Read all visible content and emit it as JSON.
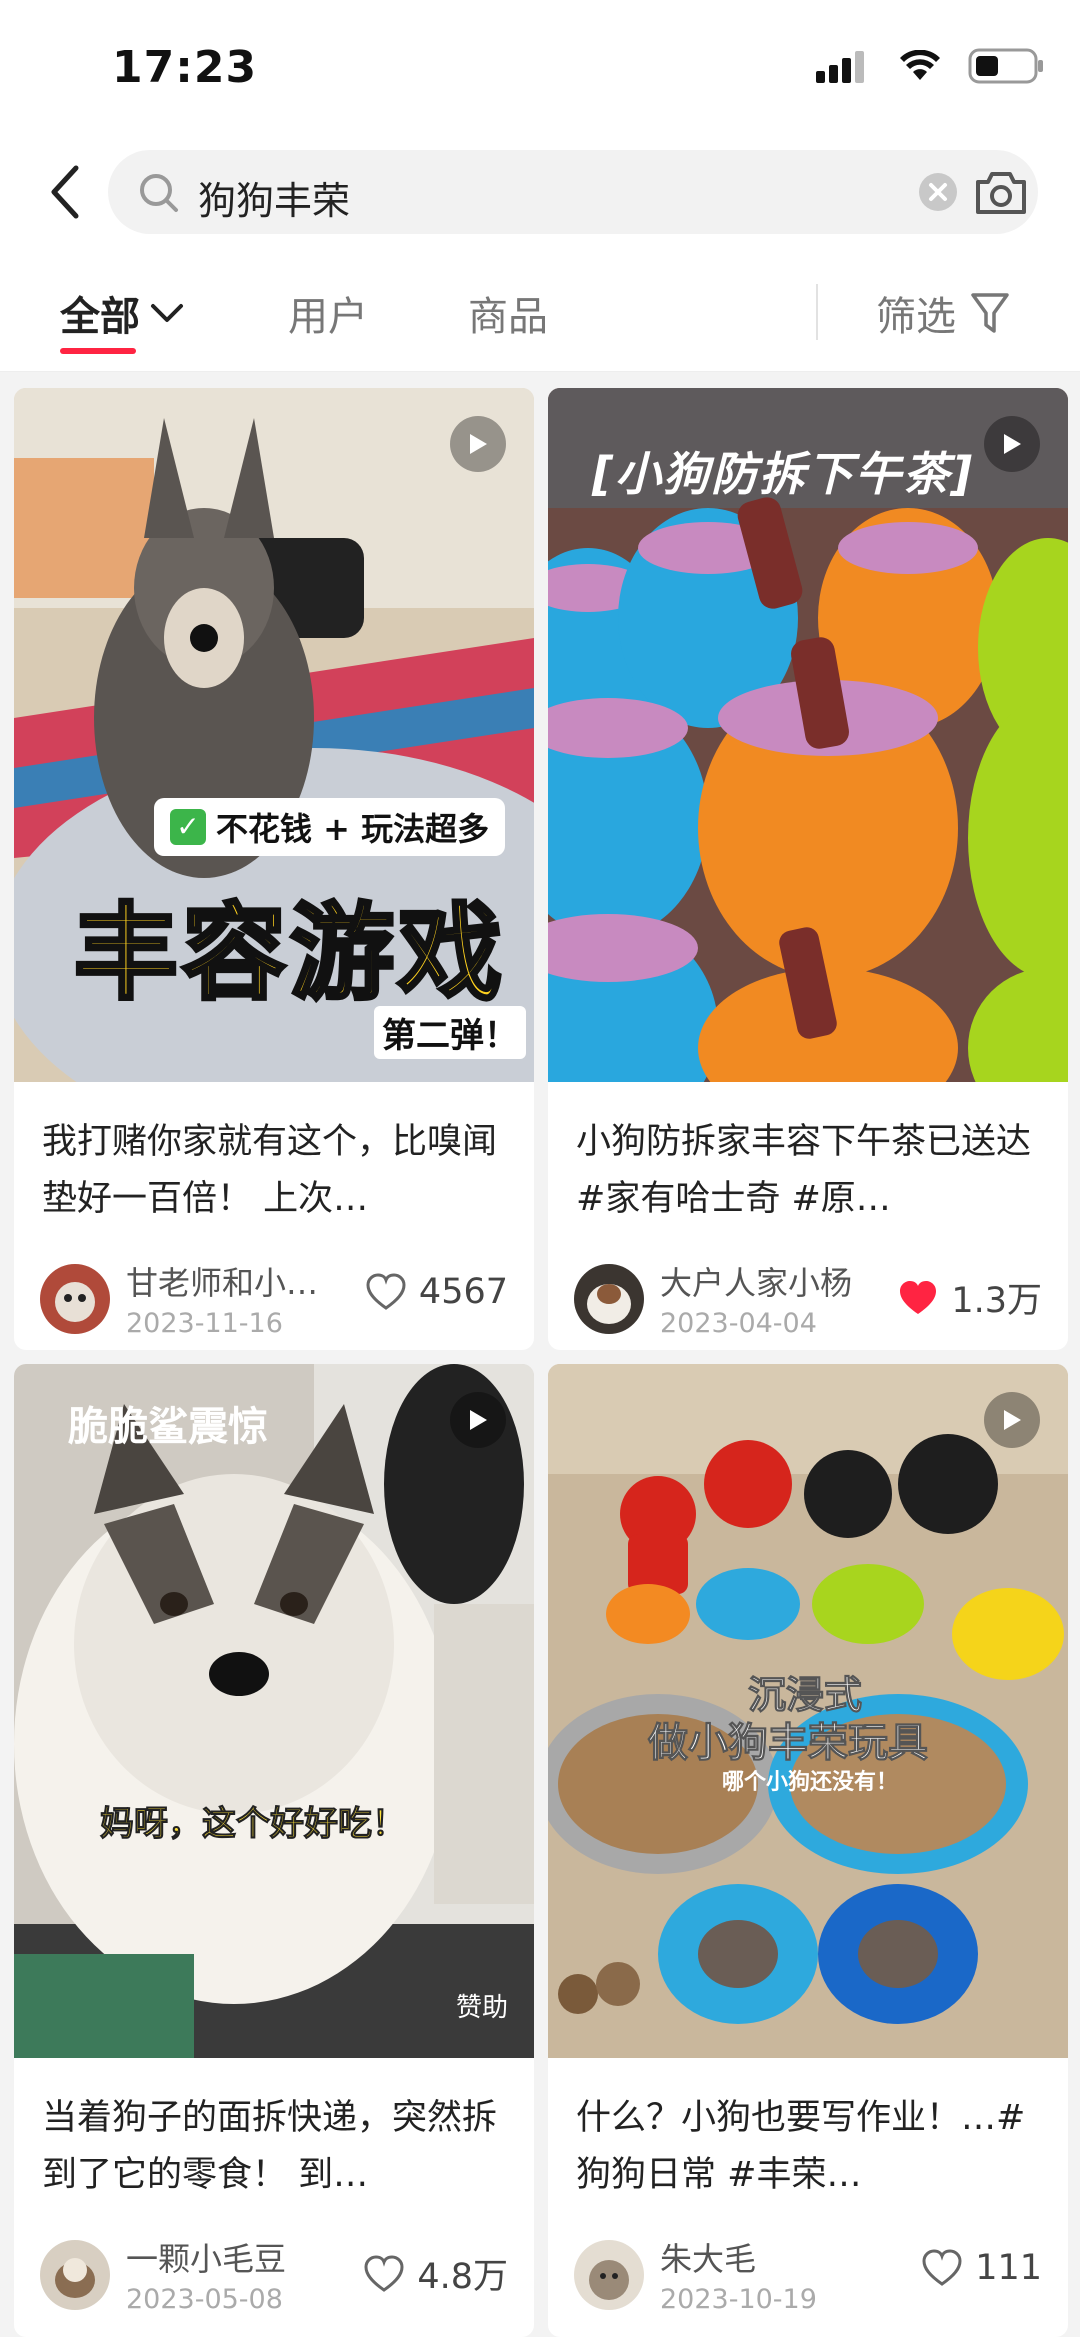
{
  "status_bar": {
    "time": "17:23"
  },
  "search": {
    "query": "狗狗丰荣"
  },
  "tabs": [
    {
      "label": "全部",
      "active": true
    },
    {
      "label": "用户"
    },
    {
      "label": "商品"
    }
  ],
  "filter_label": "筛选",
  "colors": {
    "accent": "#ff2442",
    "liked": "#ff2442"
  },
  "cards": [
    {
      "title": "我打赌你家就有这个，比嗅闻垫好一百倍！ 上次…",
      "author": "甘老师和小…",
      "date": "2023-11-16",
      "likes": "4567",
      "liked": false,
      "cover_text_1": "不花钱 + 玩法超多",
      "cover_text_2": "丰容游戏",
      "cover_text_3": "第二弹！"
    },
    {
      "title": "小狗防拆家丰容下午茶已送达 #家有哈士奇 #原…",
      "author": "大户人家小杨",
      "date": "2023-04-04",
      "likes": "1.3万",
      "liked": true,
      "cover_text_1": "[小狗防拆下午茶]"
    },
    {
      "title": "当着狗子的面拆快递，突然拆到了它的零食！ 到…",
      "author": "一颗小毛豆",
      "date": "2023-05-08",
      "likes": "4.8万",
      "liked": false,
      "cover_text_1": "脆脆鲨震惊",
      "cover_text_2": "妈呀，这个好好吃！",
      "sponsor": "赞助"
    },
    {
      "title": "什么？小狗也要写作业！…#狗狗日常 #丰荣…",
      "author": "朱大毛",
      "date": "2023-10-19",
      "likes": "111",
      "liked": false,
      "cover_text_1": "沉浸式",
      "cover_text_2": "做小狗丰荣玩具",
      "cover_text_3": "哪个小狗还没有！"
    }
  ]
}
